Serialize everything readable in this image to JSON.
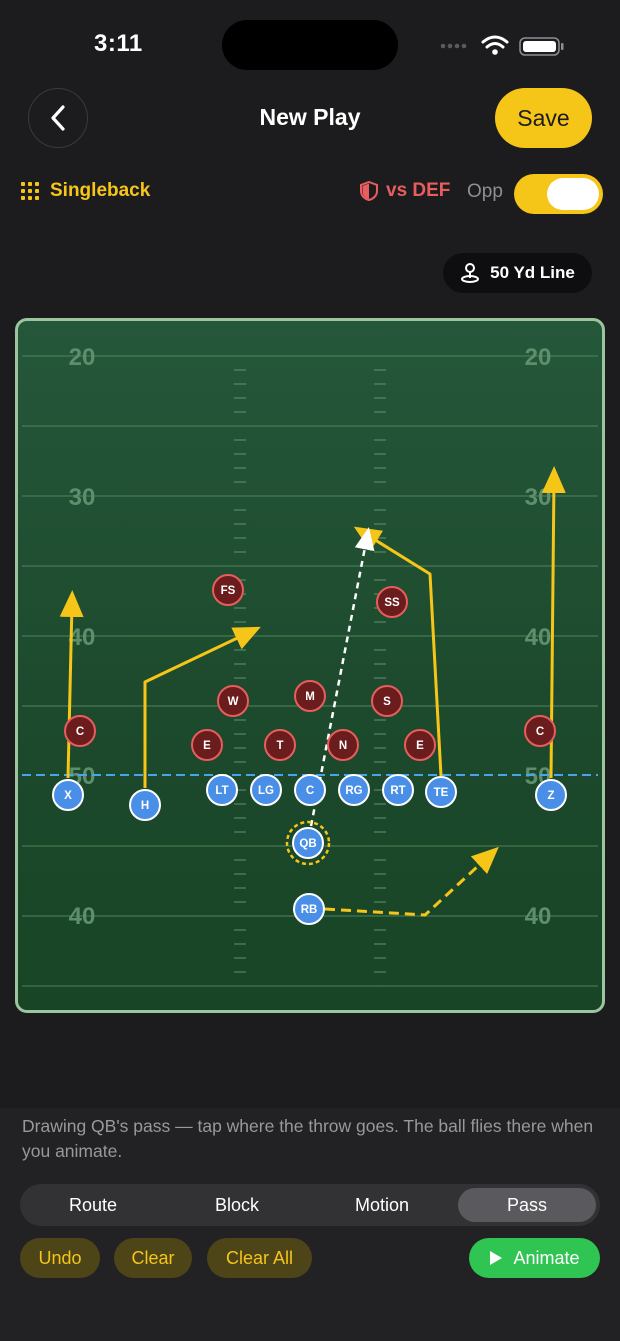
{
  "status_bar": {
    "time": "3:11"
  },
  "header": {
    "title": "New Play",
    "save_label": "Save"
  },
  "controls": {
    "formation": "Singleback",
    "vs_def_label": "vs DEF",
    "opp_label": "Opp",
    "opp_toggle_on": true,
    "yard_line_label": "50 Yd Line"
  },
  "field": {
    "yard_numbers": [
      "20",
      "30",
      "40",
      "50",
      "40"
    ],
    "offense": [
      {
        "label": "X"
      },
      {
        "label": "H"
      },
      {
        "label": "LT"
      },
      {
        "label": "LG"
      },
      {
        "label": "C"
      },
      {
        "label": "RG"
      },
      {
        "label": "RT"
      },
      {
        "label": "TE"
      },
      {
        "label": "Z"
      },
      {
        "label": "QB"
      },
      {
        "label": "RB"
      }
    ],
    "defense": [
      {
        "label": "FS"
      },
      {
        "label": "SS"
      },
      {
        "label": "W"
      },
      {
        "label": "M"
      },
      {
        "label": "S"
      },
      {
        "label": "E"
      },
      {
        "label": "T"
      },
      {
        "label": "N"
      },
      {
        "label": "E"
      },
      {
        "label": "C"
      },
      {
        "label": "C"
      }
    ]
  },
  "hint_text": "Drawing QB's pass — tap where the throw goes. The ball flies there when you animate.",
  "mode_tabs": [
    {
      "label": "Route",
      "active": false
    },
    {
      "label": "Block",
      "active": false
    },
    {
      "label": "Motion",
      "active": false
    },
    {
      "label": "Pass",
      "active": true
    }
  ],
  "actions": {
    "undo": "Undo",
    "clear": "Clear",
    "clear_all": "Clear All",
    "animate": "Animate"
  },
  "colors": {
    "accent": "#f5c518",
    "offense": "#4a8fe7",
    "defense": "#6b1c1c",
    "defense_ring": "#e85d5d",
    "animate": "#30c452"
  }
}
